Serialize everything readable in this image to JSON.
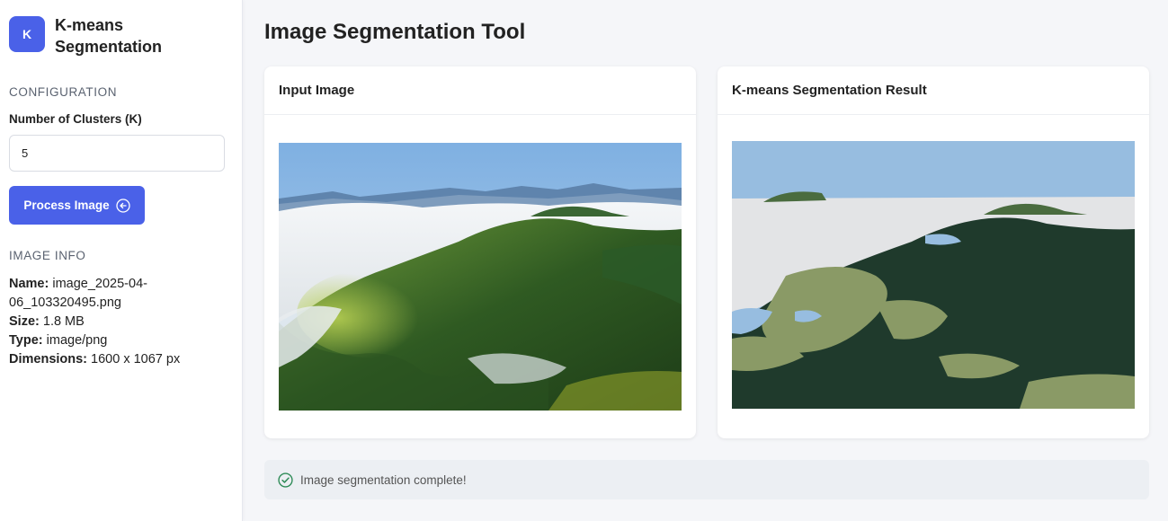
{
  "sidebar": {
    "logo_letter": "K",
    "brand": "K-means Segmentation",
    "config_title": "CONFIGURATION",
    "clusters_label": "Number of Clusters (K)",
    "clusters_value": "5",
    "process_label": "Process Image",
    "info_title": "IMAGE INFO",
    "info": {
      "name_label": "Name:",
      "name_value": "image_2025-04-06_103320495.png",
      "size_label": "Size:",
      "size_value": "1.8 MB",
      "type_label": "Type:",
      "type_value": "image/png",
      "dim_label": "Dimensions:",
      "dim_value": "1600 x 1067 px"
    }
  },
  "main": {
    "title": "Image Segmentation Tool",
    "input_card_title": "Input Image",
    "result_card_title": "K-means Segmentation Result",
    "status": "Image segmentation complete!"
  },
  "colors": {
    "accent": "#4a61e8",
    "success": "#2e8b57",
    "segment_sky": "#97bde0",
    "segment_fog": "#e3e4e6",
    "segment_dark_forest": "#1f3a2c",
    "segment_olive": "#8a9a66",
    "segment_blue_gray": "#6c8aa8"
  }
}
